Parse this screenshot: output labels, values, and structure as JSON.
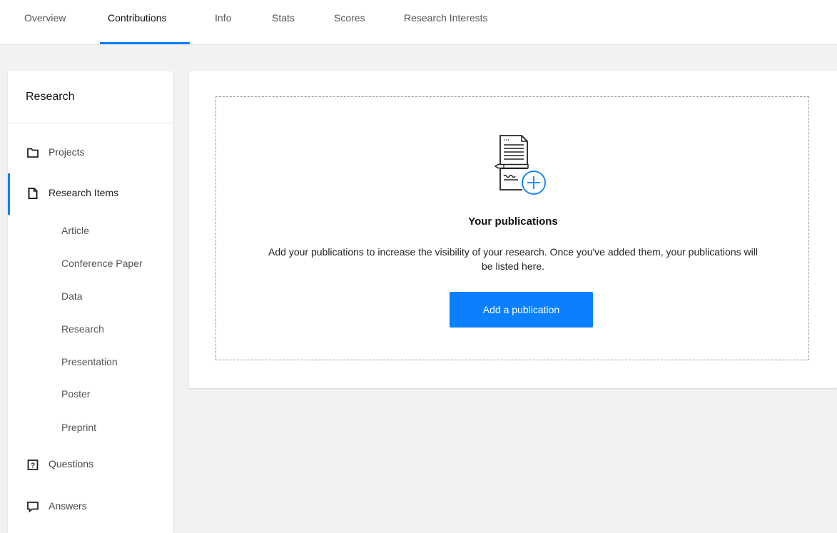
{
  "colors": {
    "accent": "#0b80ff",
    "text": "#111111",
    "muted": "#555555",
    "background": "#f2f2f2"
  },
  "tabs": [
    {
      "label": "Overview",
      "active": false
    },
    {
      "label": "Contributions",
      "active": true
    },
    {
      "label": "Info",
      "active": false
    },
    {
      "label": "Stats",
      "active": false
    },
    {
      "label": "Scores",
      "active": false
    },
    {
      "label": "Research Interests",
      "active": false
    }
  ],
  "sidebar": {
    "title": "Research",
    "items": [
      {
        "label": "Projects",
        "icon": "folder-icon",
        "active": false
      },
      {
        "label": "Research Items",
        "icon": "document-icon",
        "active": true
      },
      {
        "label": "Questions",
        "icon": "question-box-icon",
        "active": false
      },
      {
        "label": "Answers",
        "icon": "speech-bubble-icon",
        "active": false
      }
    ],
    "subitems": [
      "Article",
      "Conference Paper",
      "Data",
      "Research",
      "Presentation",
      "Poster",
      "Preprint"
    ]
  },
  "main": {
    "illustration_icon": "publication-add-icon",
    "empty_title": "Your publications",
    "empty_text": "Add your publications to increase the visibility of your research. Once you've added them, your publications will be listed here.",
    "add_button_label": "Add a publication"
  }
}
